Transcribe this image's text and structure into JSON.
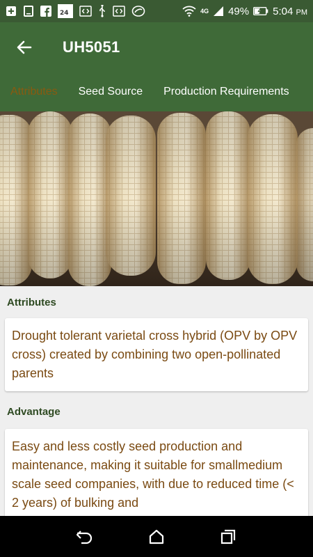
{
  "status_bar": {
    "battery_percent": "49%",
    "time": "5:04",
    "ampm": "PM",
    "network": "4G",
    "badge_text": "24"
  },
  "app_bar": {
    "title": "UH5051"
  },
  "tabs": [
    {
      "label": "Attributes",
      "active": true
    },
    {
      "label": "Seed Source",
      "active": false
    },
    {
      "label": "Production Requirements",
      "active": false
    }
  ],
  "sections": {
    "attributes": {
      "heading": "Attributes",
      "text": "Drought tolerant varietal cross hybrid (OPV by OPV cross) created by combining two open-pollinated parents"
    },
    "advantage": {
      "heading": "Advantage",
      "text": "Easy and less costly seed production and maintenance, making it suitable for smallmedium scale seed companies, with due to reduced time (< 2 years) of bulking and"
    }
  },
  "colors": {
    "status_bar": "#3a5a33",
    "app_bar": "#3f6a38",
    "active_tab": "#8a5a10",
    "section_heading": "#2e4a22",
    "body_text": "#7a4a12",
    "background": "#efefef"
  },
  "icons": {
    "back": "arrow-left-icon",
    "nav_back": "back-nav-icon",
    "nav_home": "home-nav-icon",
    "nav_recents": "recents-nav-icon"
  }
}
